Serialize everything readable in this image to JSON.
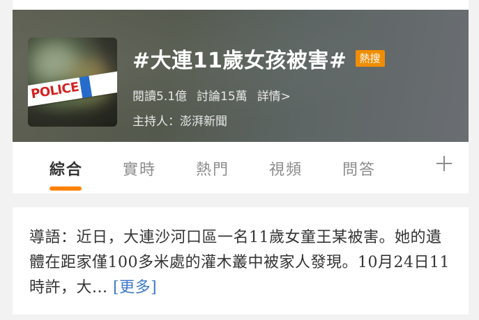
{
  "header": {
    "title": "#大連11歲女孩被害#",
    "badge": "熱搜",
    "stats": {
      "reads": "閱讀5.1億",
      "discussions": "討論15萬",
      "details": "詳情>"
    },
    "host": "主持人：澎湃新聞",
    "thumbnail_text": "POLICE"
  },
  "tabs": [
    {
      "label": "綜合",
      "active": true
    },
    {
      "label": "實時",
      "active": false
    },
    {
      "label": "熱門",
      "active": false
    },
    {
      "label": "視頻",
      "active": false
    },
    {
      "label": "問答",
      "active": false
    }
  ],
  "tab_add_icon": "plus-icon",
  "intro": {
    "text": "導語：近日，大連沙河口區一名11歲女童王某被害。她的遺體在距家僅100多米處的灌木叢中被家人發現。10月24日11時許，大...",
    "more": "[更多]"
  },
  "colors": {
    "accent": "#ff8200",
    "badge": "#f08c00",
    "link": "#3f7ac7"
  }
}
